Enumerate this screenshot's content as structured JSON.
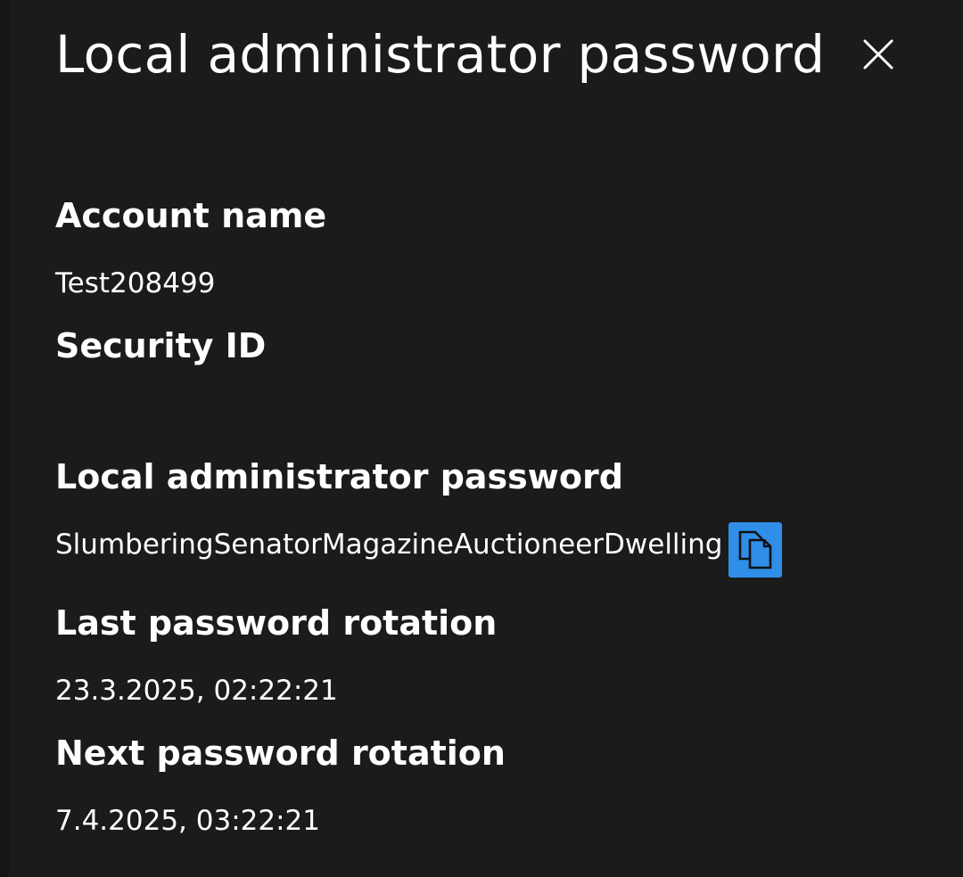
{
  "panel": {
    "title": "Local administrator password",
    "close_icon": "close-icon"
  },
  "fields": {
    "account_name": {
      "label": "Account name",
      "value": "Test208499"
    },
    "security_id": {
      "label": "Security ID",
      "value": ""
    },
    "password": {
      "label": "Local administrator password",
      "value": "SlumberingSenatorMagazineAuctioneerDwelling",
      "copy_icon": "copy-icon"
    },
    "last_rotation": {
      "label": "Last password rotation",
      "value": "23.3.2025, 02:22:21"
    },
    "next_rotation": {
      "label": "Next password rotation",
      "value": "7.4.2025, 03:22:21"
    }
  },
  "colors": {
    "background": "#1c1b1b",
    "text": "#ffffff",
    "accent": "#2f8ee8"
  }
}
